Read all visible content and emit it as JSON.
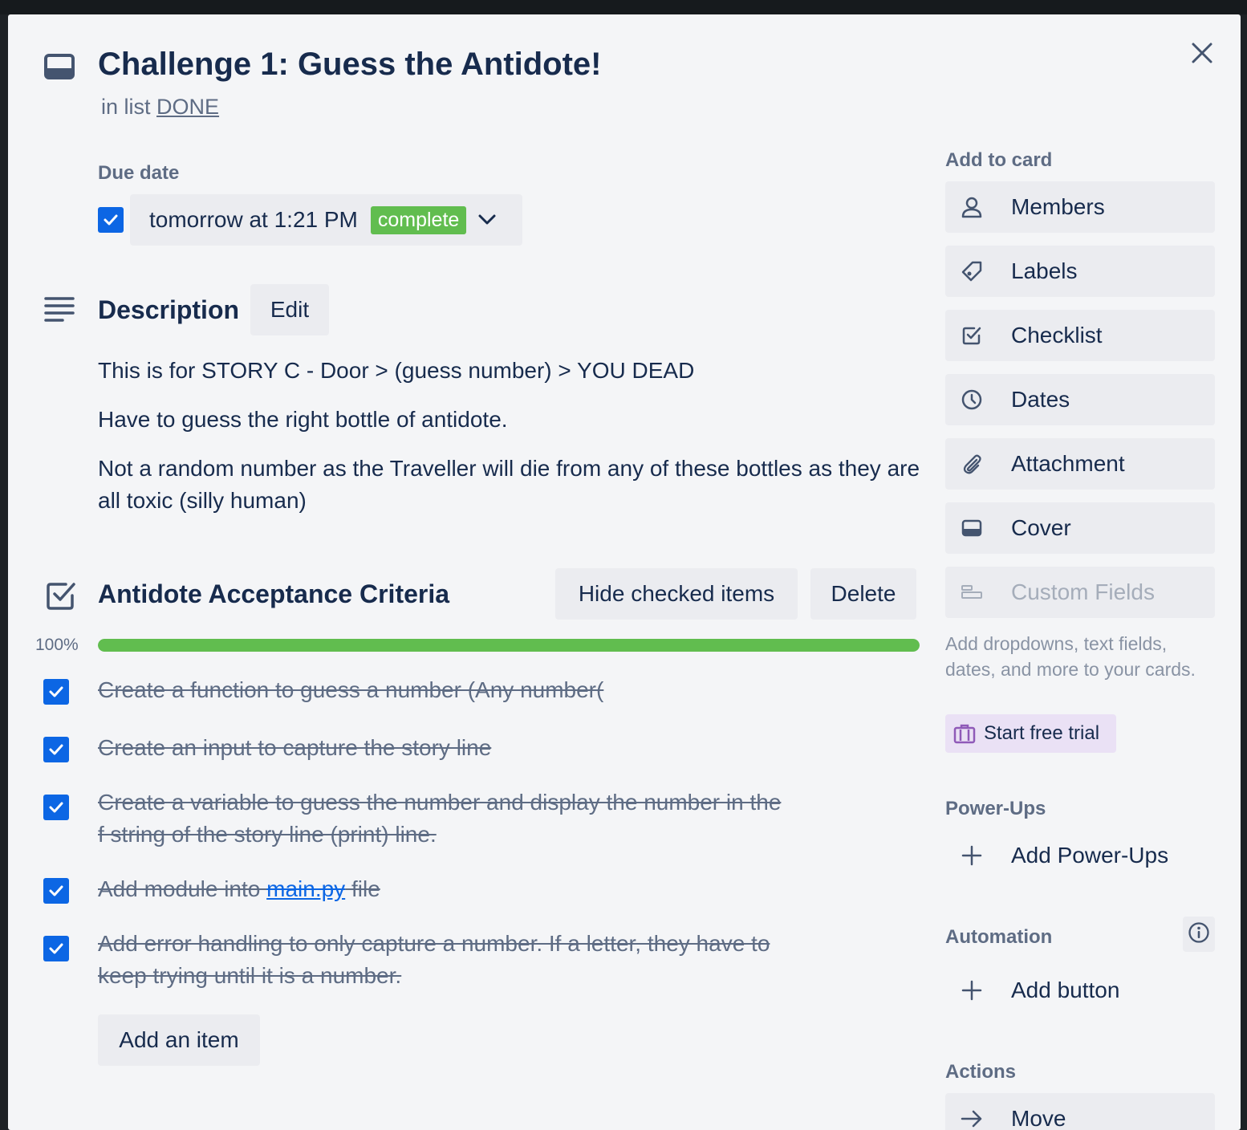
{
  "card": {
    "title": "Challenge 1: Guess the Antidote!",
    "in_list_prefix": "in list",
    "list_name": "DONE"
  },
  "due": {
    "label": "Due date",
    "value": "tomorrow at 1:21 PM",
    "status": "complete",
    "completed": true
  },
  "description": {
    "title": "Description",
    "edit_label": "Edit",
    "paragraphs": [
      "This is for STORY C - Door > (guess number) > YOU DEAD",
      "Have to guess the right bottle of antidote.",
      "Not a random number as the Traveller will die from any of these bottles as they are all toxic (silly human)"
    ]
  },
  "checklist": {
    "title": "Antidote Acceptance Criteria",
    "hide_checked_label": "Hide checked items",
    "delete_label": "Delete",
    "progress_text": "100%",
    "progress_fraction": 1.0,
    "items": [
      {
        "text": "Create a function to guess a number (Any number(",
        "checked": true
      },
      {
        "text": "Create an input to capture the story line",
        "checked": true
      },
      {
        "text": "Create a variable to guess the number and display the number in the f string of the story line (print) line.",
        "checked": true
      },
      {
        "text_before": "Add module into ",
        "link": "main.py",
        "text_after": " file",
        "checked": true
      },
      {
        "text": "Add error handling to only capture a number. If a letter, they have to keep trying until it is a number.",
        "checked": true
      }
    ],
    "add_item_label": "Add an item"
  },
  "sidebar": {
    "add_to_card_label": "Add to card",
    "buttons": [
      {
        "label": "Members",
        "icon": "person-icon"
      },
      {
        "label": "Labels",
        "icon": "tag-icon"
      },
      {
        "label": "Checklist",
        "icon": "checkbox-icon"
      },
      {
        "label": "Dates",
        "icon": "clock-icon"
      },
      {
        "label": "Attachment",
        "icon": "paperclip-icon"
      },
      {
        "label": "Cover",
        "icon": "cover-icon"
      },
      {
        "label": "Custom Fields",
        "icon": "custom-fields-icon",
        "disabled": true
      }
    ],
    "custom_fields_help": "Add dropdowns, text fields, dates, and more to your cards.",
    "trial_label": "Start free trial",
    "powerups_label": "Power-Ups",
    "add_powerups_label": "Add Power-Ups",
    "automation_label": "Automation",
    "add_button_label": "Add button",
    "actions_label": "Actions",
    "move_label": "Move"
  },
  "colors": {
    "accent_blue": "#0c66e4",
    "complete_green": "#61bd4f",
    "trial_purple": "#eae1f5"
  }
}
